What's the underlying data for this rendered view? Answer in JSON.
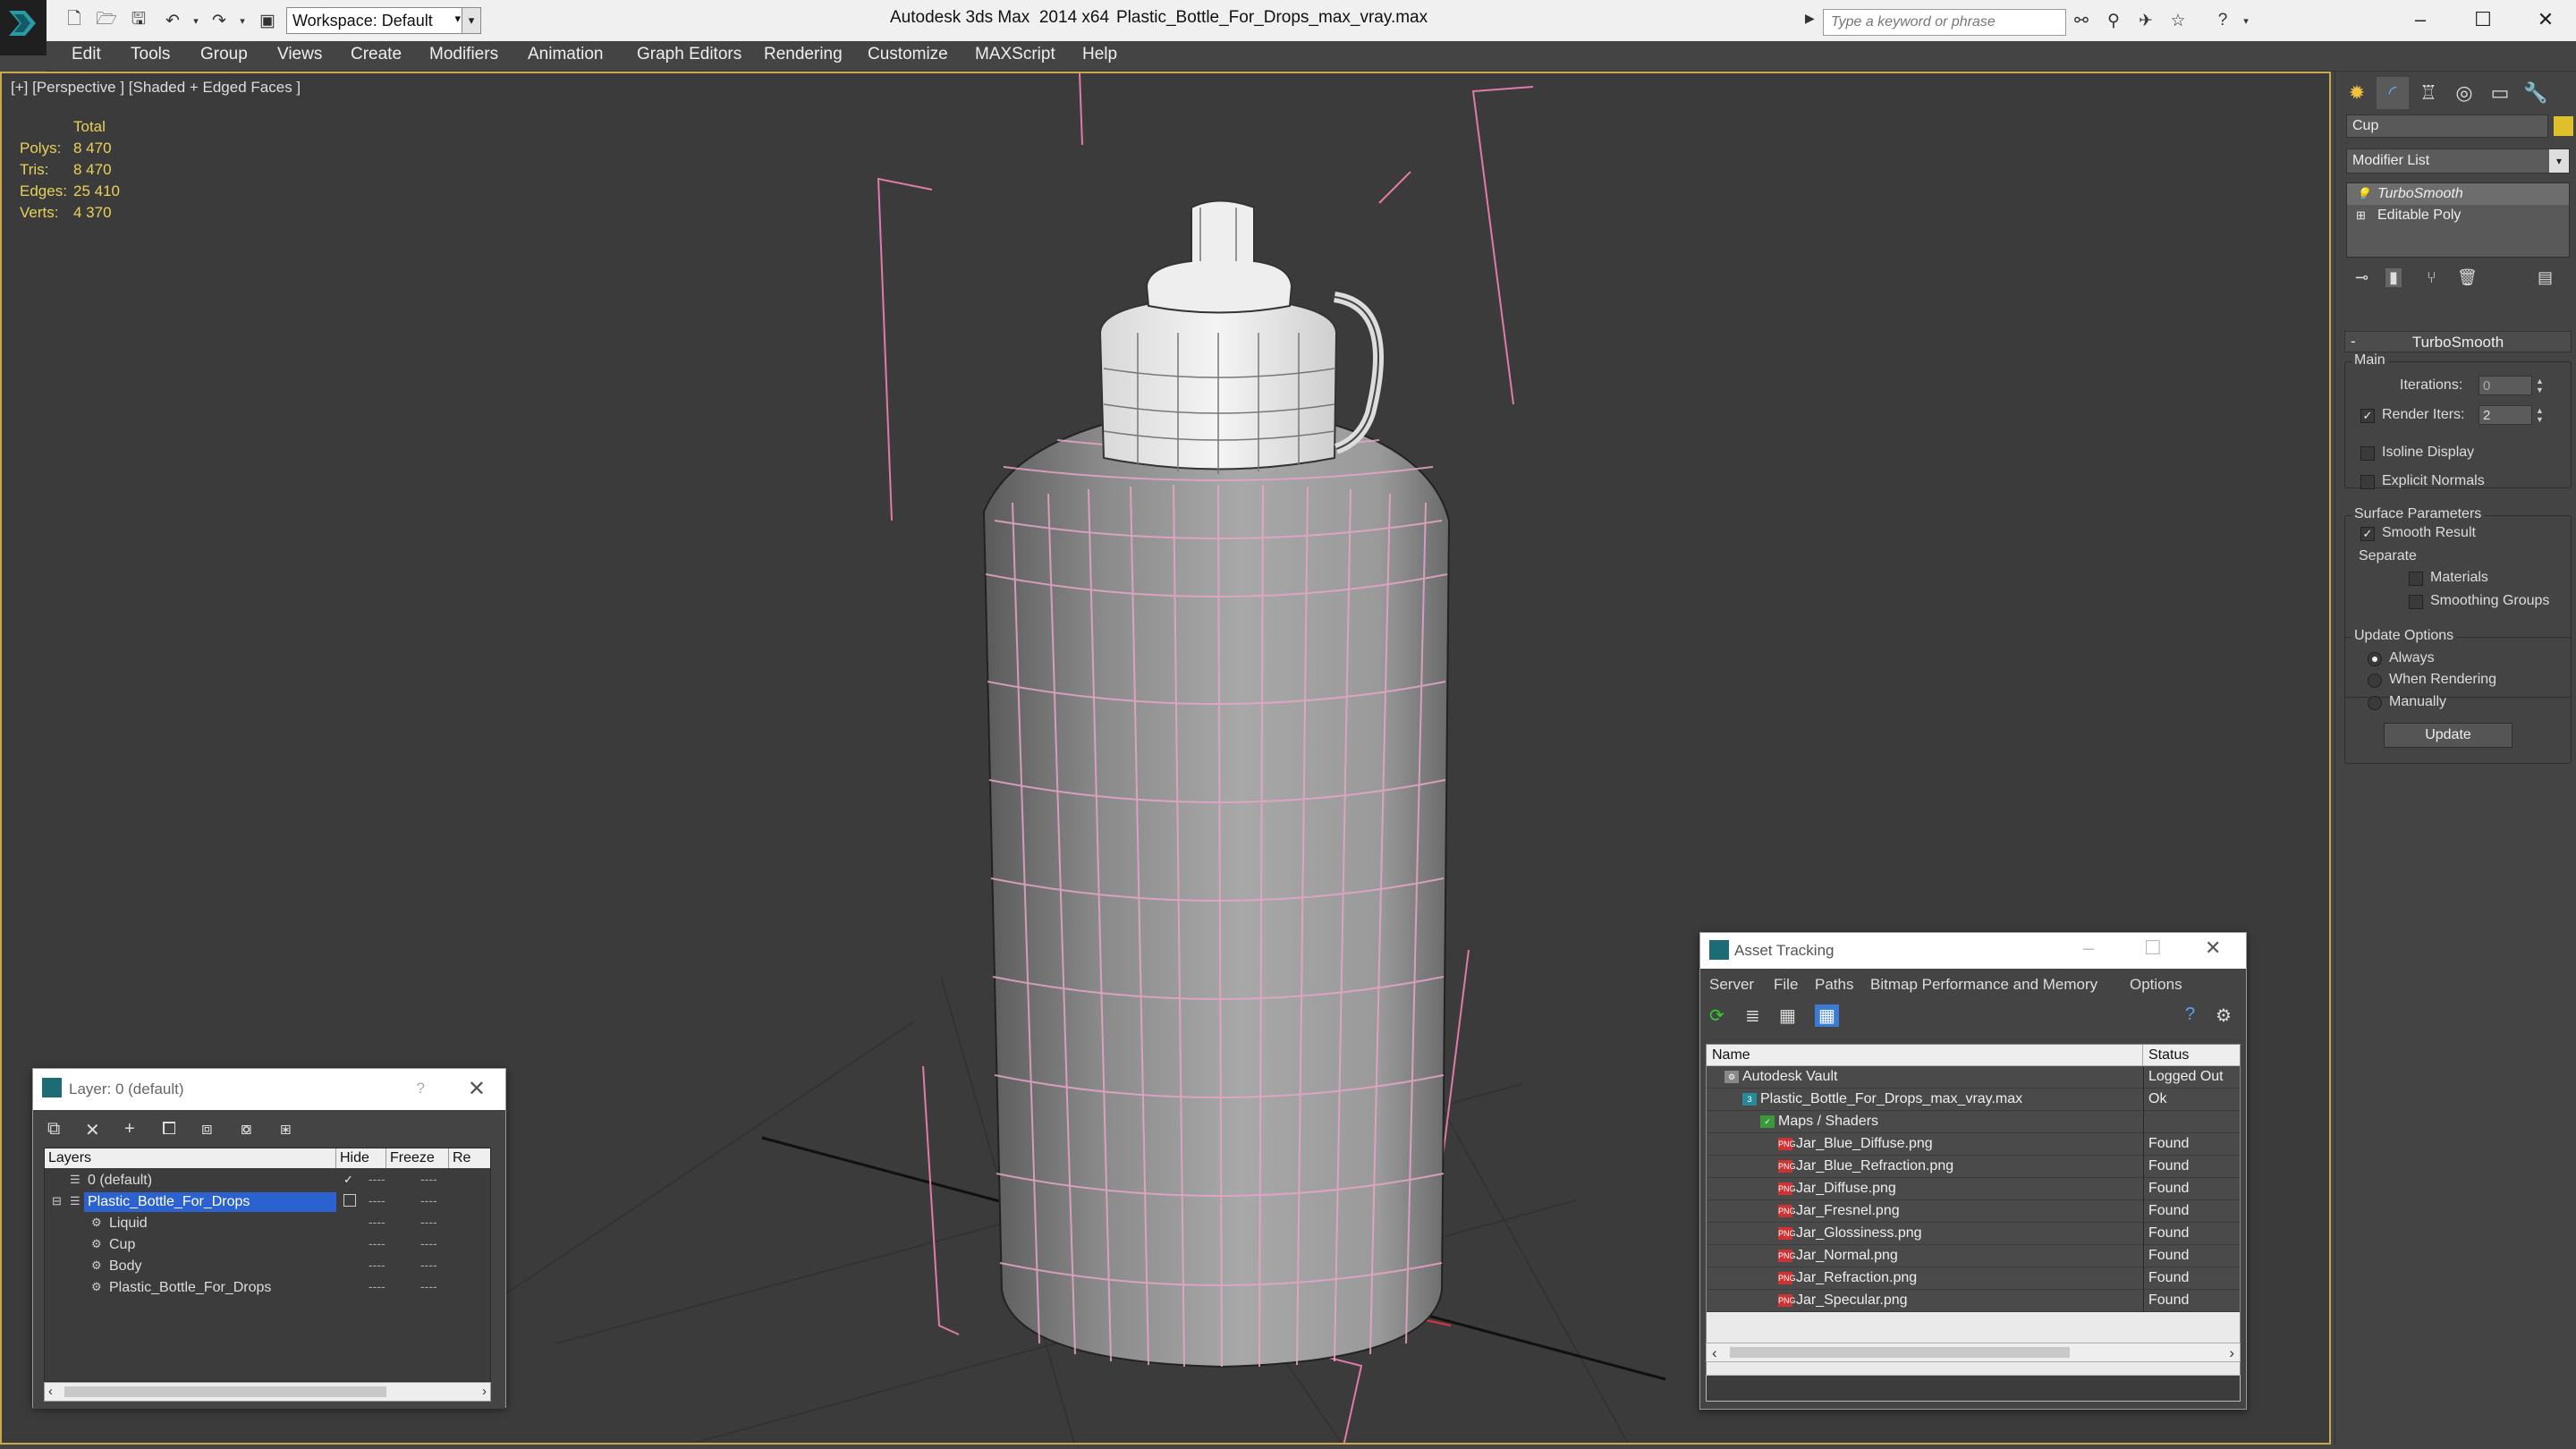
{
  "titlebar": {
    "workspace": "Workspace: Default",
    "app_title": "Autodesk 3ds Max  2014 x64",
    "file_title": "Plastic_Bottle_For_Drops_max_vray.max",
    "search_placeholder": "Type a keyword or phrase"
  },
  "menu": [
    "Edit",
    "Tools",
    "Group",
    "Views",
    "Create",
    "Modifiers",
    "Animation",
    "Graph Editors",
    "Rendering",
    "Customize",
    "MAXScript",
    "Help"
  ],
  "viewport": {
    "label": "[+] [Perspective ] [Shaded + Edged Faces ]",
    "stats_header": "Total",
    "stats": [
      {
        "key": "Polys:",
        "value": "8 470"
      },
      {
        "key": "Tris:",
        "value": "8 470"
      },
      {
        "key": "Edges:",
        "value": "25 410"
      },
      {
        "key": "Verts:",
        "value": "4 370"
      }
    ]
  },
  "command_panel": {
    "object_name": "Cup",
    "modifier_list": "Modifier List",
    "stack": [
      {
        "label": "TurboSmooth",
        "selected": true
      },
      {
        "label": "Editable Poly",
        "selected": false
      }
    ],
    "rollout": "TurboSmooth",
    "main_group": "Main",
    "iterations_label": "Iterations:",
    "iterations_value": "0",
    "render_iters_label": "Render Iters:",
    "render_iters_value": "2",
    "isoline_label": "Isoline Display",
    "explicit_label": "Explicit Normals",
    "surface_group": "Surface Parameters",
    "smooth_result_label": "Smooth Result",
    "separate_label": "Separate",
    "materials_label": "Materials",
    "smoothing_label": "Smoothing Groups",
    "update_group": "Update Options",
    "always_label": "Always",
    "when_rendering_label": "When Rendering",
    "manually_label": "Manually",
    "update_button": "Update"
  },
  "layer_dialog": {
    "title": "Layer: 0 (default)",
    "help": "?",
    "columns": [
      "Layers",
      "Hide",
      "Freeze",
      "Re"
    ],
    "rows": [
      {
        "name": "0 (default)",
        "indent": 0
      },
      {
        "name": "Plastic_Bottle_For_Drops",
        "indent": 0,
        "selected": true
      },
      {
        "name": "Liquid",
        "indent": 1
      },
      {
        "name": "Cup",
        "indent": 1
      },
      {
        "name": "Body",
        "indent": 1
      },
      {
        "name": "Plastic_Bottle_For_Drops",
        "indent": 1
      }
    ],
    "dash": "----"
  },
  "asset_dialog": {
    "title": "Asset Tracking",
    "menu": [
      "Server",
      "File",
      "Paths",
      "Bitmap Performance and Memory",
      "Options"
    ],
    "columns": [
      "Name",
      "Status"
    ],
    "rows": [
      {
        "name": "Autodesk Vault",
        "status": "Logged Out",
        "indent": 0,
        "icon": "vault"
      },
      {
        "name": "Plastic_Bottle_For_Drops_max_vray.max",
        "status": "Ok",
        "indent": 1,
        "icon": "max"
      },
      {
        "name": "Maps / Shaders",
        "status": "",
        "indent": 2,
        "icon": "maps"
      },
      {
        "name": "Jar_Blue_Diffuse.png",
        "status": "Found",
        "indent": 3,
        "icon": "png"
      },
      {
        "name": "Jar_Blue_Refraction.png",
        "status": "Found",
        "indent": 3,
        "icon": "png"
      },
      {
        "name": "Jar_Diffuse.png",
        "status": "Found",
        "indent": 3,
        "icon": "png"
      },
      {
        "name": "Jar_Fresnel.png",
        "status": "Found",
        "indent": 3,
        "icon": "png"
      },
      {
        "name": "Jar_Glossiness.png",
        "status": "Found",
        "indent": 3,
        "icon": "png"
      },
      {
        "name": "Jar_Normal.png",
        "status": "Found",
        "indent": 3,
        "icon": "png"
      },
      {
        "name": "Jar_Refraction.png",
        "status": "Found",
        "indent": 3,
        "icon": "png"
      },
      {
        "name": "Jar_Specular.png",
        "status": "Found",
        "indent": 3,
        "icon": "png"
      }
    ]
  }
}
